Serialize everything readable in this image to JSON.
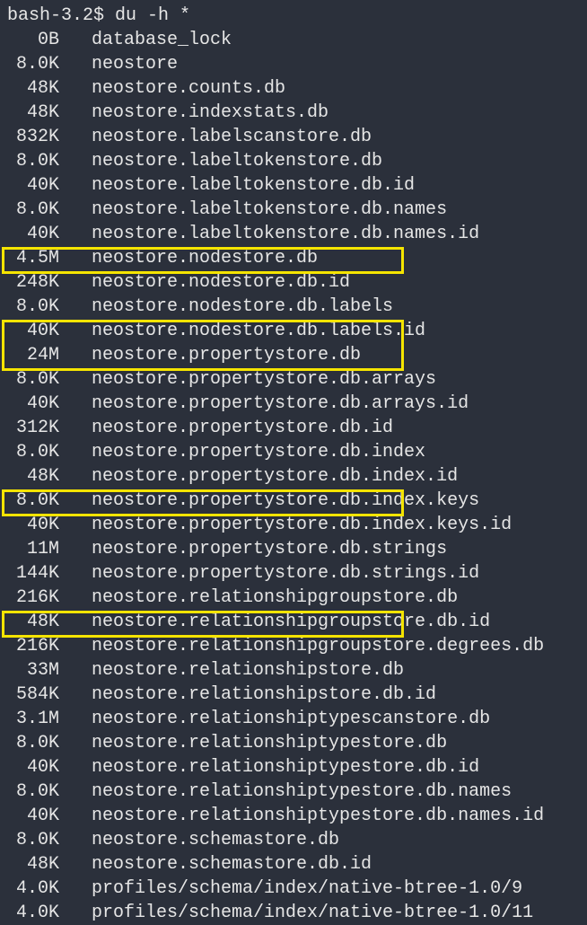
{
  "prompt": "bash-3.2$ ",
  "command": "du -h *",
  "rows": [
    {
      "size": "0B",
      "name": "database_lock"
    },
    {
      "size": "8.0K",
      "name": "neostore"
    },
    {
      "size": "48K",
      "name": "neostore.counts.db"
    },
    {
      "size": "48K",
      "name": "neostore.indexstats.db"
    },
    {
      "size": "832K",
      "name": "neostore.labelscanstore.db"
    },
    {
      "size": "8.0K",
      "name": "neostore.labeltokenstore.db"
    },
    {
      "size": "40K",
      "name": "neostore.labeltokenstore.db.id"
    },
    {
      "size": "8.0K",
      "name": "neostore.labeltokenstore.db.names"
    },
    {
      "size": "40K",
      "name": "neostore.labeltokenstore.db.names.id"
    },
    {
      "size": "4.5M",
      "name": "neostore.nodestore.db"
    },
    {
      "size": "248K",
      "name": "neostore.nodestore.db.id"
    },
    {
      "size": "8.0K",
      "name": "neostore.nodestore.db.labels"
    },
    {
      "size": "40K",
      "name": "neostore.nodestore.db.labels.id"
    },
    {
      "size": "24M",
      "name": "neostore.propertystore.db"
    },
    {
      "size": "8.0K",
      "name": "neostore.propertystore.db.arrays"
    },
    {
      "size": "40K",
      "name": "neostore.propertystore.db.arrays.id"
    },
    {
      "size": "312K",
      "name": "neostore.propertystore.db.id"
    },
    {
      "size": "8.0K",
      "name": "neostore.propertystore.db.index"
    },
    {
      "size": "48K",
      "name": "neostore.propertystore.db.index.id"
    },
    {
      "size": "8.0K",
      "name": "neostore.propertystore.db.index.keys"
    },
    {
      "size": "40K",
      "name": "neostore.propertystore.db.index.keys.id"
    },
    {
      "size": "11M",
      "name": "neostore.propertystore.db.strings"
    },
    {
      "size": "144K",
      "name": "neostore.propertystore.db.strings.id"
    },
    {
      "size": "216K",
      "name": "neostore.relationshipgroupstore.db"
    },
    {
      "size": "48K",
      "name": "neostore.relationshipgroupstore.db.id"
    },
    {
      "size": "216K",
      "name": "neostore.relationshipgroupstore.degrees.db"
    },
    {
      "size": "33M",
      "name": "neostore.relationshipstore.db"
    },
    {
      "size": "584K",
      "name": "neostore.relationshipstore.db.id"
    },
    {
      "size": "3.1M",
      "name": "neostore.relationshiptypescanstore.db"
    },
    {
      "size": "8.0K",
      "name": "neostore.relationshiptypestore.db"
    },
    {
      "size": "40K",
      "name": "neostore.relationshiptypestore.db.id"
    },
    {
      "size": "8.0K",
      "name": "neostore.relationshiptypestore.db.names"
    },
    {
      "size": "40K",
      "name": "neostore.relationshiptypestore.db.names.id"
    },
    {
      "size": "8.0K",
      "name": "neostore.schemastore.db"
    },
    {
      "size": "48K",
      "name": "neostore.schemastore.db.id"
    },
    {
      "size": "4.0K",
      "name": "profiles/schema/index/native-btree-1.0/9"
    },
    {
      "size": "4.0K",
      "name": "profiles/schema/index/native-btree-1.0/11"
    }
  ],
  "highlighted_indices": [
    9,
    13,
    14,
    21,
    26
  ]
}
